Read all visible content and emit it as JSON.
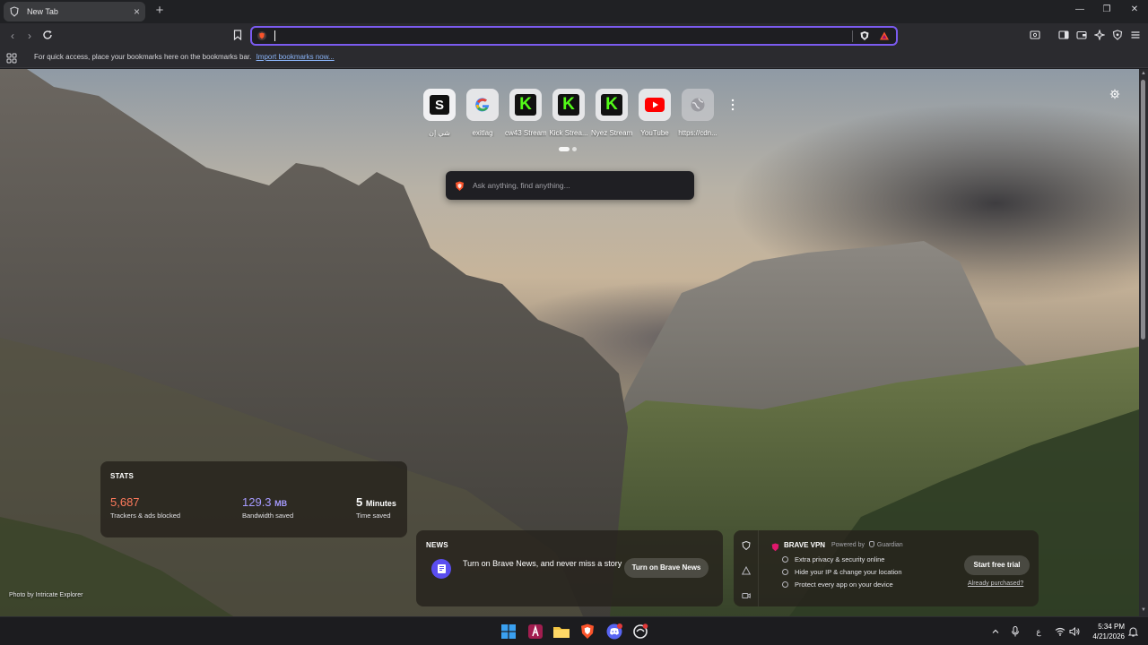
{
  "window": {
    "tab_title": "New Tab",
    "tab_close": "×",
    "new_tab": "+"
  },
  "toolbar": {
    "omnibox_value": "",
    "omnibox_placeholder": ""
  },
  "bookmarks_bar": {
    "message": "For quick access, place your bookmarks here on the bookmarks bar.",
    "import_link": "Import bookmarks now..."
  },
  "top_sites": [
    {
      "label": "شي إن",
      "glyph": "S",
      "icon": "shein-icon",
      "bg": "#111111",
      "fg": "#ffffff"
    },
    {
      "label": "exitlag",
      "glyph": "G",
      "icon": "google-icon",
      "bg": "#ffffff",
      "fg": "#4285f4"
    },
    {
      "label": "cw43 Stream",
      "glyph": "K",
      "icon": "kick-icon",
      "bg": "#111111",
      "fg": "#53fc18"
    },
    {
      "label": "Kick Strea...",
      "glyph": "K",
      "icon": "kick-icon",
      "bg": "#111111",
      "fg": "#53fc18"
    },
    {
      "label": "Nyez Stream",
      "glyph": "K",
      "icon": "kick-icon",
      "bg": "#111111",
      "fg": "#53fc18"
    },
    {
      "label": "YouTube",
      "glyph": "▶",
      "icon": "youtube-icon",
      "bg": "#ff0000",
      "fg": "#ffffff"
    },
    {
      "label": "https://cdn...",
      "glyph": "",
      "icon": "globe-icon",
      "bg": "#cfcfd4",
      "fg": "#8a8a90"
    }
  ],
  "search": {
    "placeholder": "Ask anything, find anything..."
  },
  "stats": {
    "title": "STATS",
    "trackers_value": "5,687",
    "trackers_label": "Trackers & ads blocked",
    "bandwidth_value": "129.3",
    "bandwidth_unit": "MB",
    "bandwidth_label": "Bandwidth saved",
    "time_value": "5",
    "time_unit": "Minutes",
    "time_label": "Time saved",
    "colors": {
      "trackers": "#ff7a5c",
      "bandwidth": "#a69bff",
      "time": "#ffffff"
    }
  },
  "news": {
    "title": "NEWS",
    "text": "Turn on Brave News, and never miss a story",
    "button": "Turn on Brave News"
  },
  "vpn": {
    "title": "BRAVE VPN",
    "powered_by": "Powered by",
    "partner": "Guardian",
    "features": [
      "Extra privacy & security online",
      "Hide your IP & change your location",
      "Protect every app on your device"
    ],
    "button": "Start free trial",
    "link": "Already purchased?"
  },
  "page": {
    "photo_credit": "Photo by Intricate Explorer"
  },
  "taskbar": {
    "time": "5:34 PM",
    "date": "4/21/2026",
    "keyboard_layout": "ع"
  },
  "colors": {
    "accent": "#7b5bf0",
    "brave_orange": "#fb542b"
  }
}
